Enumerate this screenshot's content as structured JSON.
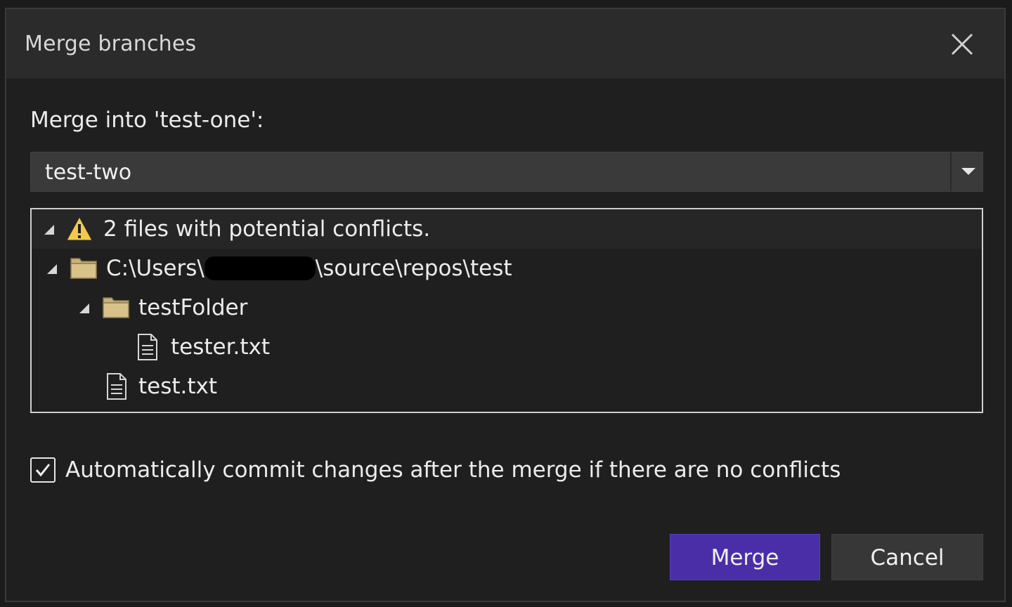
{
  "dialog": {
    "title": "Merge branches"
  },
  "merge_into": {
    "label": "Merge into 'test-one':"
  },
  "branch_select": {
    "selected": "test-two"
  },
  "conflict_tree": {
    "summary": "2 files with potential conflicts.",
    "repo_path_prefix": "C:\\Users\\",
    "repo_path_suffix": "\\source\\repos\\test",
    "folder": "testFolder",
    "folder_file": "tester.txt",
    "root_file": "test.txt"
  },
  "auto_commit": {
    "checked": true,
    "label": "Automatically commit changes after the merge if there are no conflicts"
  },
  "buttons": {
    "merge": "Merge",
    "cancel": "Cancel"
  },
  "colors": {
    "accent": "#4a2ea8",
    "warning": "#f2c94c",
    "folder": "#c9b27a"
  }
}
